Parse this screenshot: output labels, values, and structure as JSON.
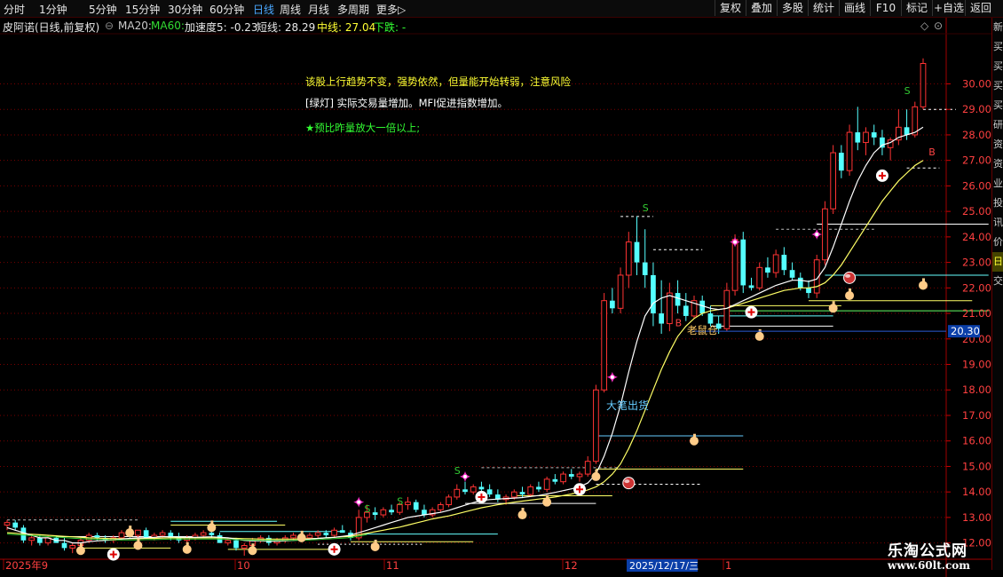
{
  "toolbar": {
    "periods": [
      "分时",
      "1分钟",
      "5分钟",
      "15分钟",
      "30分钟",
      "60分钟",
      "日线",
      "周线",
      "月线",
      "多周期",
      "更多▷"
    ],
    "active_period": "日线",
    "buttons": [
      "复权",
      "叠加",
      "多股",
      "统计",
      "画线",
      "F10",
      "标记",
      "+自选",
      "返回"
    ]
  },
  "title": {
    "stock": "皮阿诺(日线,前复权)",
    "ma20": "MA20:",
    "ma60": "MA60:",
    "accel": "加速度5: -0.23",
    "short": "短线: 28.29",
    "mid": "中线: 27.04",
    "trend": "下跌: -"
  },
  "notes": {
    "line1": "该股上行趋势不变，强势依然，但量能开始转弱，注意风险",
    "line2": "[绿灯] 实际交易量增加。MFI促进指数增加。",
    "line3": "★预比昨量放大一倍以上;"
  },
  "labels": {
    "laoshucang": "老鼠仓",
    "dabichuhuo": "大笔出货",
    "s": "S",
    "b": "B"
  },
  "price_axis": {
    "ticks": [
      "30.00",
      "29.00",
      "28.00",
      "27.00",
      "26.00",
      "25.00",
      "24.00",
      "23.00",
      "22.00",
      "21.00",
      "20.00",
      "19.00",
      "18.00",
      "17.00",
      "16.00",
      "15.00",
      "14.00",
      "13.00",
      "12.00"
    ],
    "tick_values": [
      30,
      29,
      28,
      27,
      26,
      25,
      24,
      23,
      22,
      21,
      20,
      19,
      18,
      17,
      16,
      15,
      14,
      13,
      12
    ],
    "current": "20.30"
  },
  "time_axis": {
    "labels": [
      "2025年9",
      "10",
      "11",
      "12",
      "1"
    ],
    "cursor_date": "2025/12/17/三"
  },
  "right_strip": [
    "新",
    "买",
    "买",
    "买",
    "买",
    "研",
    "资",
    "资",
    "业",
    "投",
    "讯",
    "价",
    "日",
    "交"
  ],
  "brand": {
    "name": "乐淘公式网",
    "url": "www.60lt.com"
  },
  "colors": {
    "up": "#ff3333",
    "down": "#54ffff",
    "ma_white": "#ffffff",
    "ma_yellow": "#ffff66",
    "grid": "#7a0000",
    "active_tab": "#4aa8ff",
    "title_ma20": "#cccccc",
    "title_ma60": "#33dd33",
    "note_yellow": "#ffff33",
    "note_white": "#ffffff",
    "note_green": "#33ff33"
  },
  "chart_data": {
    "type": "candlestick",
    "ylim": [
      11.5,
      31.2
    ],
    "candles": [
      [
        12.7,
        12.9,
        12.5,
        12.8
      ],
      [
        12.8,
        12.9,
        12.5,
        12.6
      ],
      [
        12.6,
        12.7,
        12.0,
        12.1
      ],
      [
        12.1,
        12.3,
        11.9,
        12.2
      ],
      [
        12.2,
        12.3,
        11.9,
        12.0
      ],
      [
        12.0,
        12.3,
        11.9,
        12.2
      ],
      [
        12.2,
        12.3,
        12.0,
        12.0
      ],
      [
        12.0,
        12.2,
        11.7,
        11.8
      ],
      [
        11.8,
        12.0,
        11.6,
        11.9
      ],
      [
        11.9,
        12.2,
        11.8,
        12.1
      ],
      [
        12.1,
        12.4,
        12.0,
        12.3
      ],
      [
        12.3,
        12.4,
        12.1,
        12.2
      ],
      [
        12.2,
        12.3,
        12.0,
        12.1
      ],
      [
        12.1,
        12.3,
        12.0,
        12.2
      ],
      [
        12.2,
        12.5,
        12.1,
        12.4
      ],
      [
        12.4,
        12.6,
        12.2,
        12.3
      ],
      [
        12.3,
        12.5,
        12.2,
        12.5
      ],
      [
        12.5,
        12.6,
        12.2,
        12.2
      ],
      [
        12.2,
        12.4,
        12.1,
        12.3
      ],
      [
        12.3,
        12.5,
        12.2,
        12.4
      ],
      [
        12.4,
        12.5,
        12.1,
        12.2
      ],
      [
        12.2,
        12.4,
        12.0,
        12.1
      ],
      [
        12.1,
        12.3,
        12.0,
        12.2
      ],
      [
        12.2,
        12.4,
        12.1,
        12.3
      ],
      [
        12.3,
        12.5,
        12.2,
        12.4
      ],
      [
        12.4,
        12.6,
        12.2,
        12.3
      ],
      [
        12.3,
        12.4,
        12.0,
        12.0
      ],
      [
        12.0,
        12.2,
        11.9,
        12.1
      ],
      [
        12.1,
        12.2,
        11.7,
        11.8
      ],
      [
        11.8,
        12.0,
        11.5,
        11.9
      ],
      [
        11.9,
        12.2,
        11.8,
        12.1
      ],
      [
        12.1,
        12.3,
        12.0,
        12.2
      ],
      [
        12.2,
        12.3,
        11.9,
        12.0
      ],
      [
        12.0,
        12.2,
        11.9,
        12.1
      ],
      [
        12.1,
        12.3,
        12.0,
        12.2
      ],
      [
        12.2,
        12.4,
        12.1,
        12.3
      ],
      [
        12.3,
        12.4,
        12.1,
        12.2
      ],
      [
        12.2,
        12.4,
        12.1,
        12.3
      ],
      [
        12.3,
        12.5,
        12.2,
        12.4
      ],
      [
        12.4,
        12.5,
        12.2,
        12.3
      ],
      [
        12.3,
        12.6,
        12.2,
        12.5
      ],
      [
        12.5,
        12.7,
        12.4,
        12.4
      ],
      [
        12.4,
        12.5,
        12.1,
        12.2
      ],
      [
        12.2,
        13.3,
        12.1,
        13.0
      ],
      [
        13.0,
        13.5,
        12.8,
        13.2
      ],
      [
        13.2,
        13.4,
        12.9,
        13.1
      ],
      [
        13.1,
        13.4,
        13.0,
        13.3
      ],
      [
        13.3,
        13.5,
        13.1,
        13.2
      ],
      [
        13.2,
        13.6,
        13.1,
        13.5
      ],
      [
        13.5,
        13.8,
        13.3,
        13.6
      ],
      [
        13.6,
        13.7,
        13.2,
        13.3
      ],
      [
        13.3,
        13.5,
        13.0,
        13.1
      ],
      [
        13.1,
        13.4,
        13.0,
        13.3
      ],
      [
        13.3,
        13.6,
        13.2,
        13.5
      ],
      [
        13.5,
        13.9,
        13.4,
        13.8
      ],
      [
        13.8,
        14.3,
        13.7,
        14.1
      ],
      [
        14.1,
        14.4,
        13.9,
        14.0
      ],
      [
        14.0,
        14.3,
        13.9,
        14.2
      ],
      [
        14.2,
        14.4,
        14.0,
        14.1
      ],
      [
        14.1,
        14.3,
        13.8,
        13.9
      ],
      [
        13.9,
        14.1,
        13.6,
        13.7
      ],
      [
        13.7,
        13.9,
        13.5,
        13.8
      ],
      [
        13.8,
        14.1,
        13.7,
        14.0
      ],
      [
        14.0,
        14.2,
        13.8,
        13.9
      ],
      [
        13.9,
        14.3,
        13.8,
        14.2
      ],
      [
        14.2,
        14.4,
        14.0,
        14.1
      ],
      [
        14.1,
        14.6,
        14.0,
        14.5
      ],
      [
        14.5,
        14.7,
        14.3,
        14.4
      ],
      [
        14.4,
        14.8,
        14.3,
        14.7
      ],
      [
        14.7,
        14.9,
        14.5,
        14.6
      ],
      [
        14.6,
        14.8,
        14.4,
        14.7
      ],
      [
        14.7,
        15.4,
        14.6,
        15.2
      ],
      [
        15.2,
        18.2,
        15.1,
        18.0
      ],
      [
        18.0,
        21.8,
        17.9,
        21.5
      ],
      [
        21.5,
        22.0,
        21.0,
        21.2
      ],
      [
        21.2,
        22.8,
        21.0,
        22.5
      ],
      [
        22.5,
        24.2,
        22.0,
        23.8
      ],
      [
        23.8,
        24.8,
        22.5,
        23.0
      ],
      [
        23.0,
        24.3,
        22.0,
        22.5
      ],
      [
        22.5,
        23.0,
        20.5,
        21.0
      ],
      [
        21.0,
        22.3,
        20.2,
        20.6
      ],
      [
        20.6,
        22.2,
        20.3,
        21.8
      ],
      [
        21.8,
        22.3,
        21.0,
        21.3
      ],
      [
        21.3,
        21.8,
        20.7,
        20.9
      ],
      [
        20.9,
        21.7,
        20.8,
        21.5
      ],
      [
        21.5,
        21.7,
        20.9,
        21.0
      ],
      [
        21.0,
        21.3,
        20.5,
        20.6
      ],
      [
        20.6,
        20.9,
        20.2,
        20.4
      ],
      [
        20.4,
        22.2,
        20.3,
        21.9
      ],
      [
        21.9,
        24.1,
        21.7,
        23.9
      ],
      [
        23.9,
        24.2,
        21.8,
        22.1
      ],
      [
        22.1,
        22.4,
        21.9,
        22.0
      ],
      [
        22.0,
        23.0,
        21.9,
        22.8
      ],
      [
        22.8,
        23.2,
        22.4,
        22.6
      ],
      [
        22.6,
        23.5,
        22.4,
        23.3
      ],
      [
        23.3,
        23.6,
        22.5,
        22.7
      ],
      [
        22.7,
        23.0,
        22.3,
        22.4
      ],
      [
        22.4,
        22.6,
        21.9,
        22.0
      ],
      [
        22.0,
        22.3,
        21.6,
        21.8
      ],
      [
        21.8,
        23.3,
        21.6,
        23.1
      ],
      [
        23.1,
        25.4,
        22.9,
        25.1
      ],
      [
        25.1,
        27.6,
        24.9,
        27.3
      ],
      [
        27.3,
        27.6,
        26.3,
        26.6
      ],
      [
        26.6,
        28.4,
        26.4,
        28.1
      ],
      [
        28.1,
        29.1,
        27.4,
        27.7
      ],
      [
        27.7,
        28.3,
        27.2,
        28.1
      ],
      [
        28.1,
        28.4,
        27.6,
        27.9
      ],
      [
        27.9,
        28.2,
        27.2,
        27.5
      ],
      [
        27.5,
        27.9,
        27.0,
        27.8
      ],
      [
        27.8,
        29.0,
        27.6,
        28.3
      ],
      [
        28.3,
        29.0,
        27.8,
        28.0
      ],
      [
        28.0,
        29.3,
        27.9,
        29.1
      ],
      [
        29.1,
        31.0,
        29.0,
        30.8
      ]
    ],
    "ma_white": [
      12.6,
      12.5,
      12.4,
      12.3,
      12.2,
      12.2,
      12.1,
      12.1,
      12.0,
      12.0,
      12.05,
      12.08,
      12.1,
      12.12,
      12.15,
      12.18,
      12.2,
      12.2,
      12.22,
      12.24,
      12.24,
      12.23,
      12.22,
      12.22,
      12.23,
      12.24,
      12.22,
      12.2,
      12.15,
      12.1,
      12.08,
      12.08,
      12.07,
      12.07,
      12.08,
      12.1,
      12.12,
      12.15,
      12.18,
      12.2,
      12.22,
      12.26,
      12.3,
      12.4,
      12.5,
      12.6,
      12.7,
      12.8,
      12.9,
      13.0,
      13.05,
      13.1,
      13.15,
      13.2,
      13.28,
      13.38,
      13.48,
      13.58,
      13.66,
      13.7,
      13.72,
      13.74,
      13.76,
      13.78,
      13.82,
      13.86,
      13.92,
      13.98,
      14.05,
      14.12,
      14.2,
      14.35,
      14.7,
      15.4,
      16.3,
      17.4,
      18.7,
      19.9,
      20.9,
      21.4,
      21.6,
      21.7,
      21.6,
      21.5,
      21.4,
      21.3,
      21.2,
      21.15,
      21.2,
      21.35,
      21.5,
      21.65,
      21.8,
      21.95,
      22.1,
      22.2,
      22.3,
      22.3,
      22.25,
      22.35,
      22.8,
      23.6,
      24.5,
      25.4,
      26.2,
      26.8,
      27.3,
      27.6,
      27.7,
      27.9,
      28.0,
      28.1,
      28.3
    ],
    "ma_yellow": [
      12.4,
      12.38,
      12.36,
      12.34,
      12.32,
      12.3,
      12.28,
      12.26,
      12.24,
      12.22,
      12.2,
      12.19,
      12.18,
      12.17,
      12.17,
      12.17,
      12.17,
      12.18,
      12.18,
      12.19,
      12.2,
      12.2,
      12.2,
      12.2,
      12.2,
      12.2,
      12.2,
      12.19,
      12.18,
      12.17,
      12.16,
      12.15,
      12.15,
      12.15,
      12.15,
      12.15,
      12.16,
      12.17,
      12.18,
      12.2,
      12.22,
      12.24,
      12.26,
      12.32,
      12.38,
      12.44,
      12.5,
      12.56,
      12.62,
      12.7,
      12.78,
      12.86,
      12.94,
      13.0,
      13.06,
      13.14,
      13.22,
      13.3,
      13.38,
      13.44,
      13.5,
      13.55,
      13.6,
      13.64,
      13.68,
      13.72,
      13.76,
      13.8,
      13.86,
      13.92,
      14.0,
      14.08,
      14.2,
      14.4,
      14.7,
      15.1,
      15.7,
      16.4,
      17.2,
      18.0,
      18.8,
      19.5,
      20.1,
      20.5,
      20.8,
      21.0,
      21.1,
      21.15,
      21.2,
      21.3,
      21.4,
      21.5,
      21.6,
      21.7,
      21.8,
      21.9,
      21.95,
      22.0,
      22.0,
      22.05,
      22.2,
      22.5,
      22.9,
      23.4,
      23.9,
      24.4,
      24.9,
      25.4,
      25.8,
      26.2,
      26.5,
      26.8,
      27.0
    ]
  }
}
